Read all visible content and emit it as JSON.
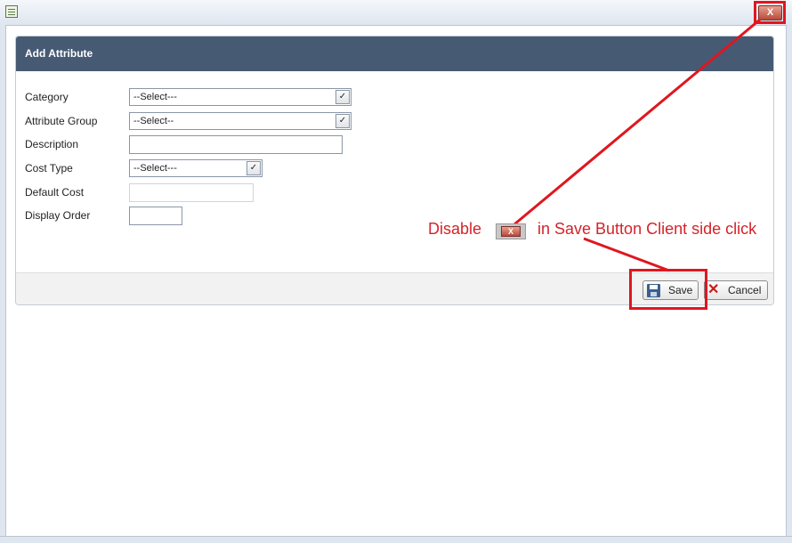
{
  "window": {
    "close_glyph": "X"
  },
  "panel": {
    "title": "Add Attribute",
    "fields": [
      {
        "label": "Category",
        "value": "--Select---"
      },
      {
        "label": "Attribute Group",
        "value": "--Select--"
      },
      {
        "label": "Description",
        "value": ""
      },
      {
        "label": "Cost Type",
        "value": "--Select---"
      },
      {
        "label": "Default Cost",
        "value": ""
      },
      {
        "label": "Display Order",
        "value": ""
      }
    ],
    "buttons": {
      "save": "Save",
      "cancel": "Cancel"
    }
  },
  "annotation": {
    "prefix": "Disable",
    "suffix": "in Save Button Client side click",
    "color": "#d4232a"
  },
  "colors": {
    "header": "#465a74",
    "highlight": "#e0161f"
  }
}
